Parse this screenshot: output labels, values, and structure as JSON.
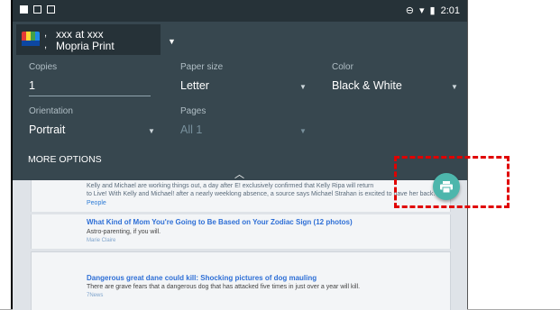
{
  "status_bar": {
    "time": "2:01"
  },
  "printer": {
    "bullets": ",\n,",
    "name_line1": "xxx at xxx",
    "name_line2": "Mopria Print"
  },
  "fields": {
    "copies": {
      "label": "Copies",
      "value": "1"
    },
    "paper_size": {
      "label": "Paper size",
      "value": "Letter"
    },
    "color": {
      "label": "Color",
      "value": "Black & White"
    },
    "orientation": {
      "label": "Orientation",
      "value": "Portrait"
    },
    "pages": {
      "label": "Pages",
      "value": "All 1"
    }
  },
  "more_options": "MORE OPTIONS",
  "content": {
    "article1_line1": "Kelly and Michael are working things out, a day after E! exclusively confirmed that Kelly Ripa will return",
    "article1_line2": "to Live! With Kelly and Michael! after a nearly weeklong absence, a source says Michael Strahan is excited to have her back.",
    "article1_source": "People",
    "article2_title": "What Kind of Mom You're Going to Be Based on Your Zodiac Sign",
    "article2_count": "(12 photos)",
    "article2_sub": "Astro-parenting, if you will.",
    "article2_source": "Marie Claire",
    "article3_title": "Dangerous great dane could kill: Shocking pictures of dog mauling",
    "article3_sub": "There are grave fears that a dangerous dog that has attacked five times in just over a year will kill.",
    "article3_source": "7News"
  },
  "colors": {
    "panel": "#37474f",
    "status_bar": "#263238",
    "fab": "#4db6ac",
    "highlight": "#e00000"
  }
}
